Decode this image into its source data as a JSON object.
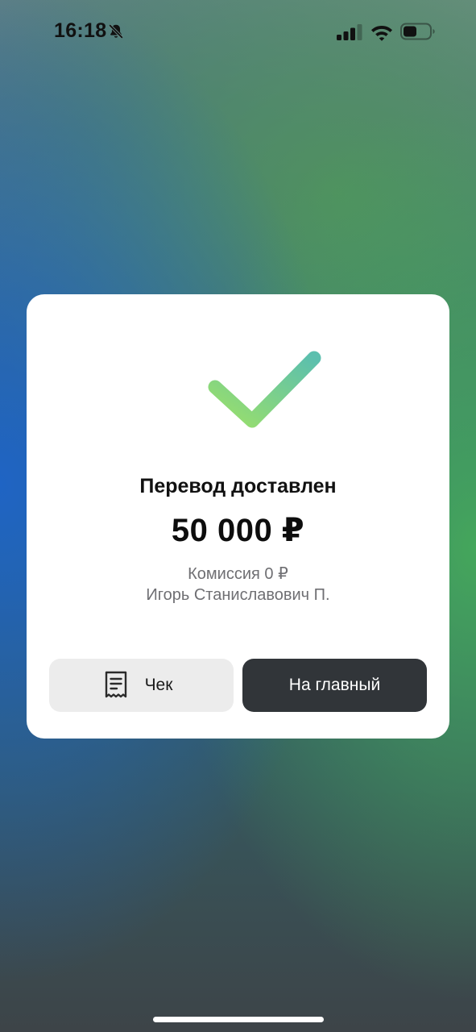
{
  "status_bar": {
    "time": "16:18",
    "icons": [
      "bell-slash-icon",
      "cellular-signal-icon",
      "wifi-icon",
      "battery-icon"
    ]
  },
  "card": {
    "status_icon": "check-icon",
    "title": "Перевод доставлен",
    "amount": "50 000 ₽",
    "fee": "Комиссия 0 ₽",
    "recipient": "Игорь Станиславович П."
  },
  "buttons": {
    "receipt_label": "Чек",
    "receipt_icon": "receipt-icon",
    "home_label": "На главный"
  },
  "colors": {
    "check_gradient_start": "#9be06a",
    "check_gradient_end": "#5bbfae",
    "primary_button": "#313539",
    "secondary_button": "#ececec"
  }
}
